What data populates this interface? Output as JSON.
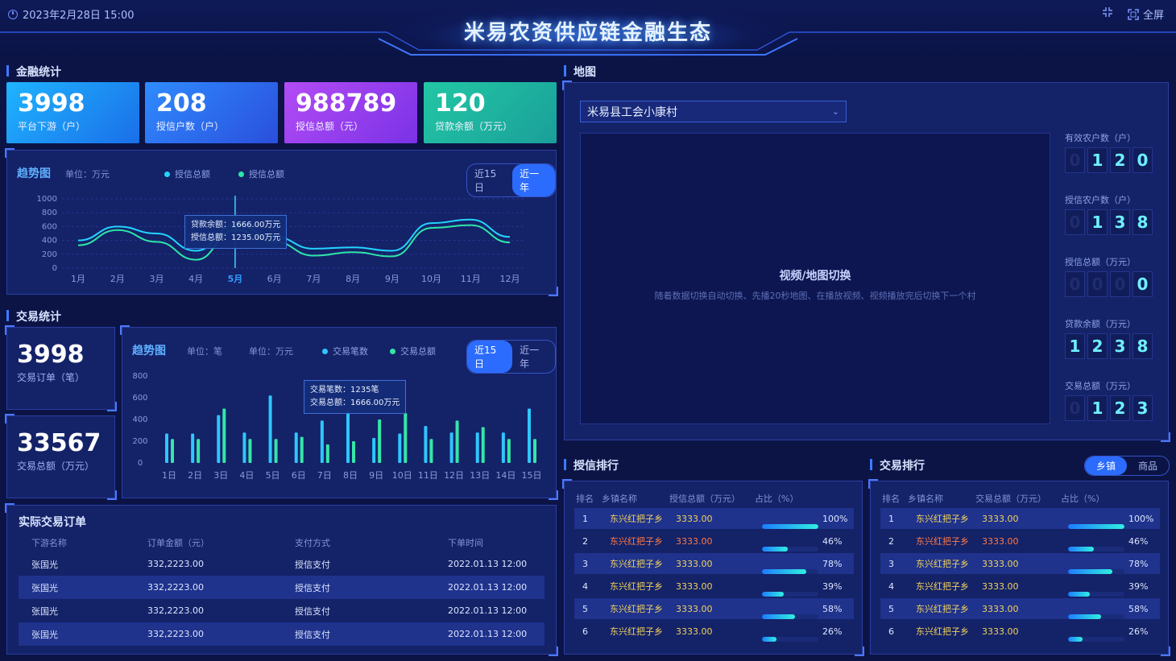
{
  "header": {
    "datetime": "2023年2月28日 15:00",
    "title": "米易农资供应链金融生态",
    "fullscreen_label": "全屏"
  },
  "finance": {
    "section_title": "金融统计",
    "kpis": [
      {
        "value": "3998",
        "label": "平台下游（户）",
        "color": "#1b9bff"
      },
      {
        "value": "208",
        "label": "授信户数（户）",
        "color": "#2e6ff2"
      },
      {
        "value": "988789",
        "label": "授信总额（元）",
        "color": "#a23ef2"
      },
      {
        "value": "120",
        "label": "贷款余额（万元）",
        "color": "#1fb6a2"
      }
    ],
    "trend": {
      "title": "趋势图",
      "unit": "单位：万元",
      "legend": [
        "授信总额",
        "授信总额"
      ],
      "ranges": [
        "近15日",
        "近一年"
      ],
      "tooltip_line1": "贷款余额：1666.00万元",
      "tooltip_line2": "授信总额：1235.00万元"
    }
  },
  "trade": {
    "section_title": "交易统计",
    "orders_value": "3998",
    "orders_label": "交易订单（笔）",
    "amount_value": "33567",
    "amount_label": "交易总额（万元）",
    "trend": {
      "title": "趋势图",
      "unit1": "单位：笔",
      "unit2": "单位：万元",
      "legend": [
        "交易笔数",
        "交易总额"
      ],
      "ranges": [
        "近15日",
        "近一年"
      ],
      "tooltip_line1": "交易笔数：1235笔",
      "tooltip_line2": "交易总额：1666.00万元"
    }
  },
  "orders": {
    "title": "实际交易订单",
    "headers": [
      "下游名称",
      "订单金额（元）",
      "支付方式",
      "下单时间"
    ],
    "rows": [
      [
        "张国光",
        "332,2223.00",
        "授信支付",
        "2022.01.13  12:00"
      ],
      [
        "张国光",
        "332,2223.00",
        "授信支付",
        "2022.01.13  12:00"
      ],
      [
        "张国光",
        "332,2223.00",
        "授信支付",
        "2022.01.13  12:00"
      ],
      [
        "张国光",
        "332,2223.00",
        "授信支付",
        "2022.01.13  12:00"
      ]
    ]
  },
  "map": {
    "section_title": "地图",
    "village": "米易县工会小康村",
    "placeholder_title": "视频/地图切换",
    "placeholder_desc": "随着数据切换自动切换、先播20秒地图、在播放视频、视频播放完后切换下一个村",
    "stats": [
      {
        "label": "有效农户数（户）",
        "digits": [
          "0",
          "1",
          "2",
          "0"
        ]
      },
      {
        "label": "授信农户数（户）",
        "digits": [
          "0",
          "1",
          "3",
          "8"
        ]
      },
      {
        "label": "授信总额（万元）",
        "digits": [
          "0",
          "0",
          "0",
          "0"
        ]
      },
      {
        "label": "贷款余额（万元）",
        "digits": [
          "1",
          "2",
          "3",
          "8"
        ]
      },
      {
        "label": "交易总额（万元）",
        "digits": [
          "0",
          "1",
          "2",
          "3"
        ]
      }
    ]
  },
  "credit_rank": {
    "section_title": "授信排行",
    "headers": [
      "排名",
      "乡镇名称",
      "授信总额（万元）",
      "占比（%）"
    ],
    "rows": [
      {
        "rank": "1",
        "name": "东兴红把子乡",
        "amount": "3333.00",
        "pct": "100%",
        "fill": 1.0
      },
      {
        "rank": "2",
        "name": "东兴红把子乡",
        "amount": "3333.00",
        "pct": "46%",
        "fill": 0.46
      },
      {
        "rank": "3",
        "name": "东兴红把子乡",
        "amount": "3333.00",
        "pct": "78%",
        "fill": 0.78
      },
      {
        "rank": "4",
        "name": "东兴红把子乡",
        "amount": "3333.00",
        "pct": "39%",
        "fill": 0.39
      },
      {
        "rank": "5",
        "name": "东兴红把子乡",
        "amount": "3333.00",
        "pct": "58%",
        "fill": 0.58
      },
      {
        "rank": "6",
        "name": "东兴红把子乡",
        "amount": "3333.00",
        "pct": "26%",
        "fill": 0.26
      }
    ]
  },
  "trade_rank": {
    "section_title": "交易排行",
    "tabs": [
      "乡镇",
      "商品"
    ],
    "headers": [
      "排名",
      "乡镇名称",
      "交易总额（万元）",
      "占比（%）"
    ],
    "rows": [
      {
        "rank": "1",
        "name": "东兴红把子乡",
        "amount": "3333.00",
        "pct": "100%",
        "fill": 1.0
      },
      {
        "rank": "2",
        "name": "东兴红把子乡",
        "amount": "3333.00",
        "pct": "46%",
        "fill": 0.46
      },
      {
        "rank": "3",
        "name": "东兴红把子乡",
        "amount": "3333.00",
        "pct": "78%",
        "fill": 0.78
      },
      {
        "rank": "4",
        "name": "东兴红把子乡",
        "amount": "3333.00",
        "pct": "39%",
        "fill": 0.39
      },
      {
        "rank": "5",
        "name": "东兴红把子乡",
        "amount": "3333.00",
        "pct": "58%",
        "fill": 0.58
      },
      {
        "rank": "6",
        "name": "东兴红把子乡",
        "amount": "3333.00",
        "pct": "26%",
        "fill": 0.26
      }
    ]
  },
  "chart_data": [
    {
      "type": "line",
      "title": "趋势图",
      "categories": [
        "1月",
        "2月",
        "3月",
        "4月",
        "5月",
        "6月",
        "7月",
        "8月",
        "9月",
        "10月",
        "11月",
        "12月"
      ],
      "yticks": [
        "1000",
        "800",
        "600",
        "400",
        "200",
        "0"
      ],
      "ylim": [
        0,
        1000
      ],
      "series": [
        {
          "name": "授信总额",
          "color": "#23d4ff",
          "values": [
            400,
            600,
            500,
            250,
            620,
            450,
            280,
            300,
            250,
            650,
            700,
            450
          ]
        },
        {
          "name": "授信总额",
          "color": "#2ee6a8",
          "values": [
            330,
            550,
            380,
            120,
            550,
            380,
            180,
            230,
            170,
            580,
            620,
            370
          ]
        }
      ]
    },
    {
      "type": "bar",
      "title": "趋势图",
      "categories": [
        "1日",
        "2日",
        "3日",
        "4日",
        "5日",
        "6日",
        "7日",
        "8日",
        "9日",
        "10日",
        "11日",
        "12日",
        "13日",
        "14日",
        "15日"
      ],
      "yticks": [
        "800",
        "600",
        "400",
        "200",
        "0"
      ],
      "ylim": [
        0,
        800
      ],
      "series": [
        {
          "name": "交易笔数",
          "color": "#2fc6ff",
          "values": [
            270,
            270,
            440,
            280,
            620,
            280,
            390,
            480,
            230,
            270,
            340,
            280,
            280,
            280,
            500
          ]
        },
        {
          "name": "交易总额",
          "color": "#35e6a8",
          "values": [
            220,
            220,
            500,
            220,
            220,
            240,
            170,
            200,
            400,
            460,
            220,
            390,
            330,
            220,
            220
          ]
        }
      ]
    }
  ]
}
